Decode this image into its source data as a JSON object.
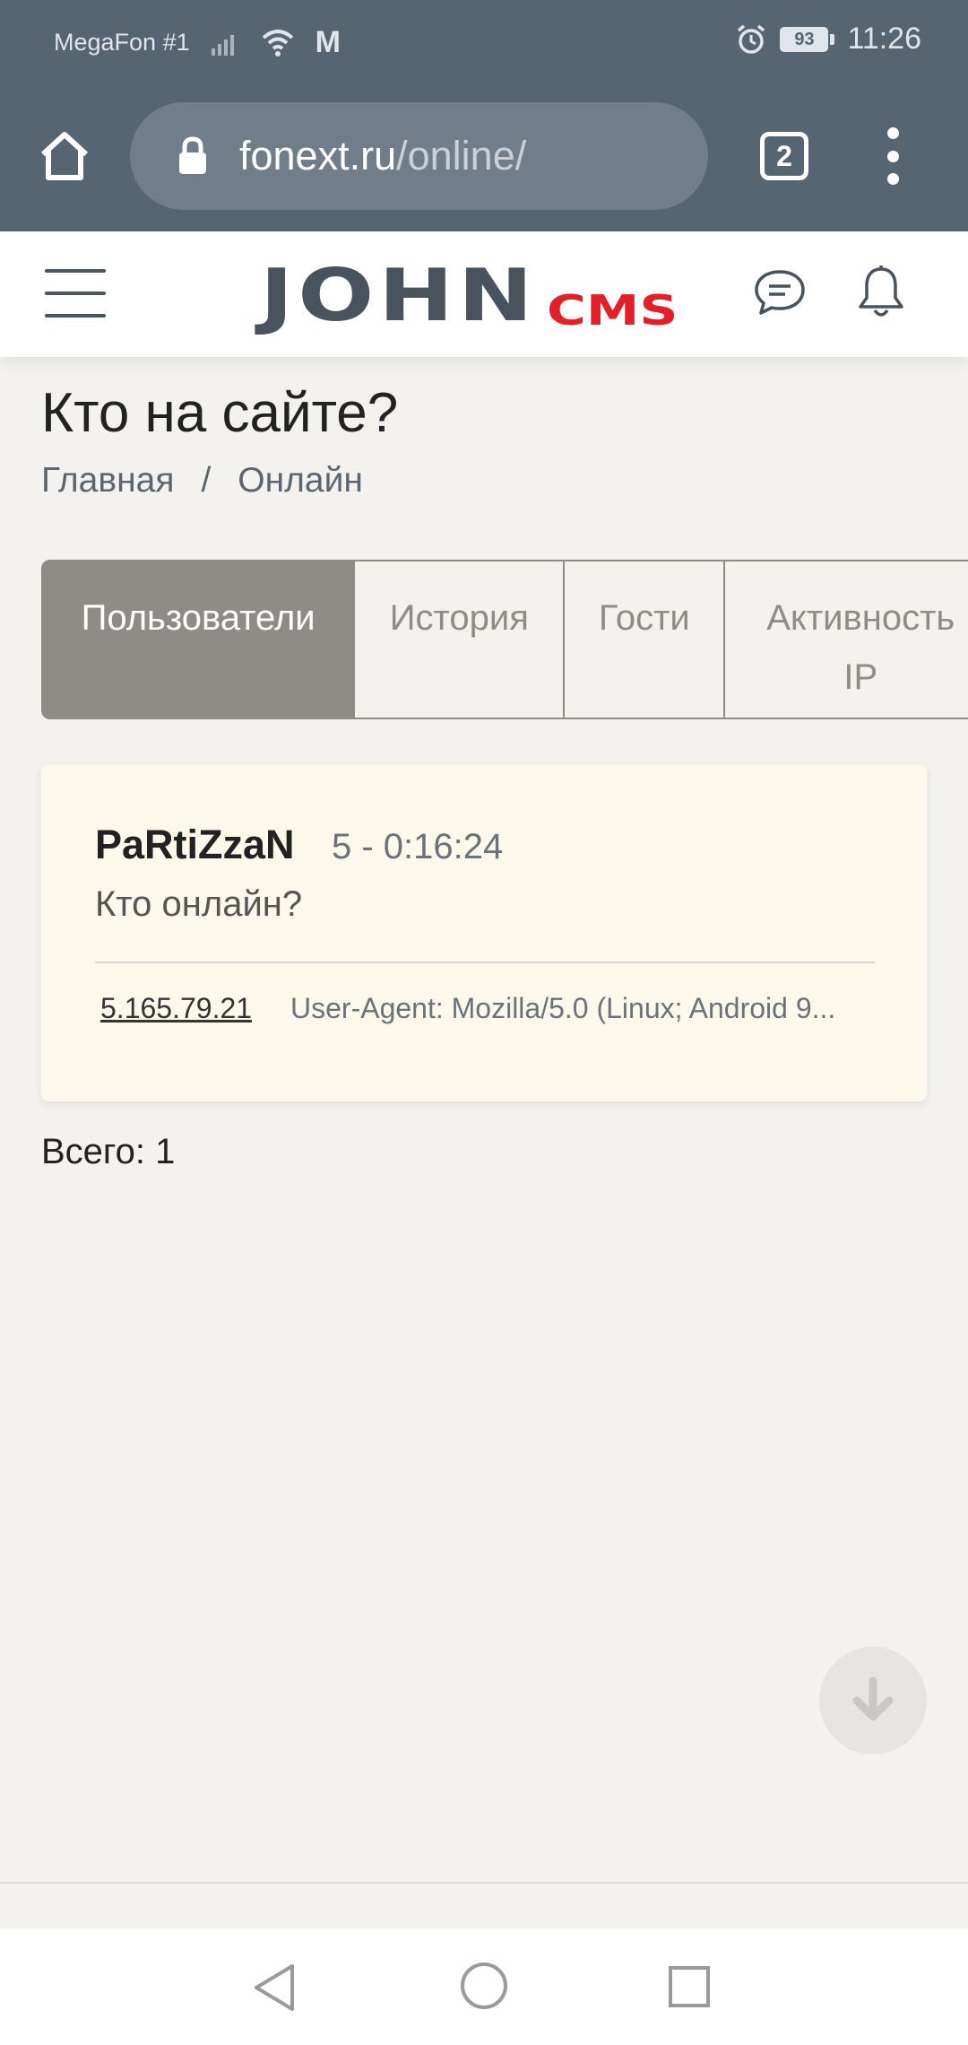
{
  "status": {
    "carrier": "MegaFon #1",
    "mail_indicator": "M",
    "battery": "93",
    "time": "11:26"
  },
  "browser": {
    "url_host": "fonext.ru",
    "url_path": "/online/",
    "tab_count": "2"
  },
  "header": {
    "logo_main": "JOHN",
    "logo_sub": "CMS"
  },
  "page": {
    "title": "Кто на сайте?",
    "breadcrumb": [
      "Главная",
      "/",
      "Онлайн"
    ]
  },
  "tabs": [
    {
      "label": "Пользователи",
      "active": true
    },
    {
      "label": "История",
      "active": false
    },
    {
      "label": "Гости",
      "active": false
    },
    {
      "label": "Активность IP",
      "active": false
    }
  ],
  "online_entry": {
    "username": "PaRtiZzaN",
    "time": "5 - 0:16:24",
    "location": "Кто онлайн?",
    "ip": "5.165.79.21",
    "user_agent": "User-Agent: Mozilla/5.0 (Linux; Android 9..."
  },
  "total": "Всего: 1",
  "colors": {
    "statusbar": "#566572",
    "tab_active": "#8f8c87",
    "card_bg": "#fdf9ea",
    "logo_red": "#e3202a",
    "logo_gray": "#48535d"
  }
}
